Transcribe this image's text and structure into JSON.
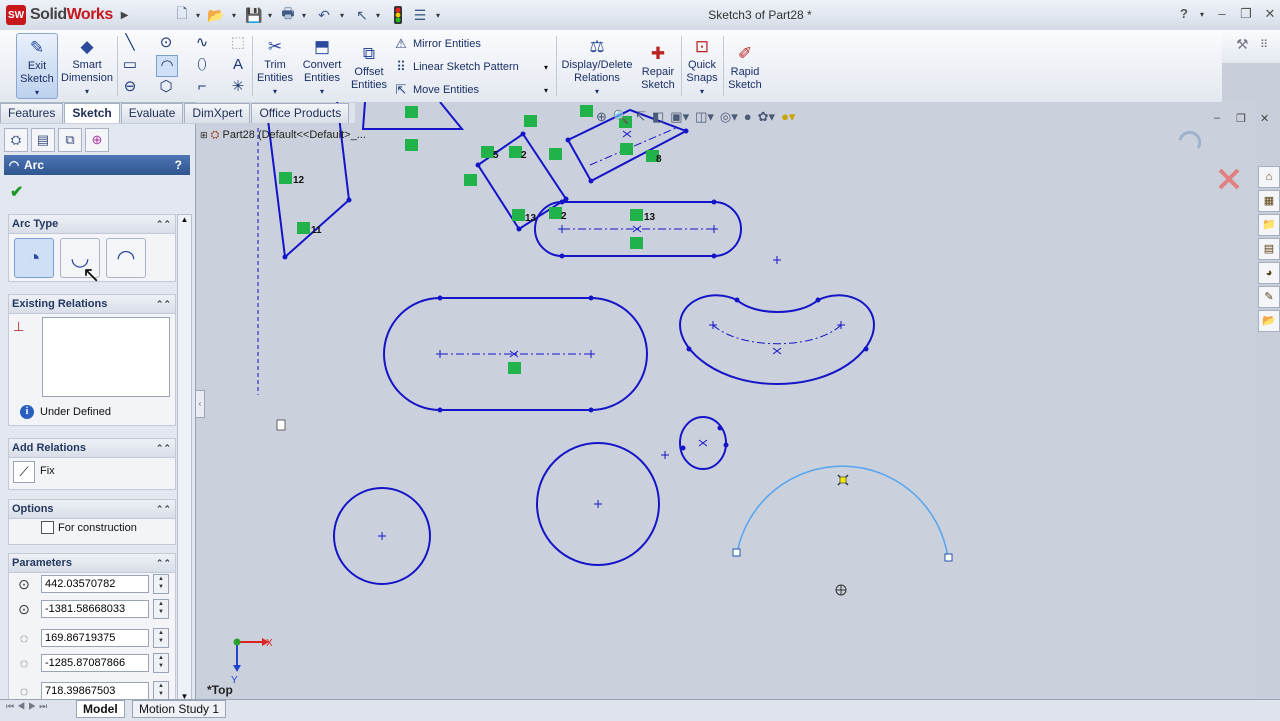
{
  "app": {
    "brand_prefix": "Solid",
    "brand_suffix": "Works",
    "logo_badge": "SW",
    "document_title": "Sketch3 of Part28 *",
    "help": "?"
  },
  "command_manager": {
    "exit_sketch": "Exit\nSketch",
    "smart_dimension": "Smart\nDimension",
    "trim_entities": "Trim\nEntities",
    "convert_entities": "Convert\nEntities",
    "offset_entities": "Offset\nEntities",
    "mirror_entities": "Mirror Entities",
    "linear_sketch_pattern": "Linear Sketch Pattern",
    "move_entities": "Move Entities",
    "display_delete_relations": "Display/Delete\nRelations",
    "repair_sketch": "Repair\nSketch",
    "quick_snaps": "Quick\nSnaps",
    "rapid_sketch": "Rapid\nSketch"
  },
  "tabs": [
    "Features",
    "Sketch",
    "Evaluate",
    "DimXpert",
    "Office Products"
  ],
  "active_tab": "Sketch",
  "property_manager": {
    "title": "Arc",
    "help": "?",
    "ok": "✔",
    "arc_type": {
      "heading": "Arc Type"
    },
    "existing_relations": {
      "heading": "Existing Relations",
      "status": "Under Defined"
    },
    "add_relations": {
      "heading": "Add Relations",
      "fix_label": "Fix"
    },
    "options": {
      "heading": "Options",
      "for_construction": "For construction",
      "for_construction_checked": false
    },
    "parameters": {
      "heading": "Parameters",
      "values": [
        "442.03570782",
        "-1381.58668033",
        "169.86719375",
        "-1285.87087866",
        "718.39867503"
      ]
    }
  },
  "feature_tree": {
    "root": "Part28  (Default<<Default>_..."
  },
  "graphics": {
    "view_label": "*Top",
    "axis_x": "X",
    "axis_y": "Y",
    "relation_numbers": [
      "12",
      "11",
      "5",
      "2",
      "13",
      "2",
      "13",
      "8"
    ],
    "sketch_color": "#1515c8",
    "preview_arc_color": "#5aa6f0",
    "relation_badge_color": "#21b24a"
  },
  "bottom_tabs": [
    "Model",
    "Motion Study 1"
  ],
  "active_bottom_tab": "Model"
}
